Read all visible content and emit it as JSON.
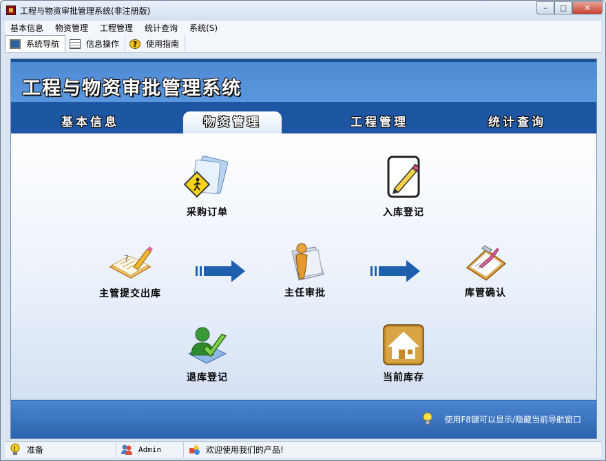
{
  "window": {
    "title": "工程与物资审批管理系统(非注册版)",
    "buttons": {
      "minimize": "–",
      "maximize": "□",
      "close": "✕"
    }
  },
  "menu": {
    "items": [
      {
        "label": "基本信息"
      },
      {
        "label": "物资管理"
      },
      {
        "label": "工程管理"
      },
      {
        "label": "统计查询"
      },
      {
        "label": "系统(S)"
      }
    ]
  },
  "toolbar": {
    "items": [
      {
        "label": "系统导航",
        "icon": "monitor-icon",
        "active": true
      },
      {
        "label": "信息操作",
        "icon": "grid-icon",
        "active": false
      },
      {
        "label": "使用指南",
        "icon": "help-icon",
        "active": false
      }
    ]
  },
  "banner": {
    "title": "工程与物资审批管理系统"
  },
  "tabs": [
    {
      "label": "基本信息",
      "active": false
    },
    {
      "label": "物资管理",
      "active": true
    },
    {
      "label": "工程管理",
      "active": false
    },
    {
      "label": "统计查询",
      "active": false
    }
  ],
  "nodes": {
    "purchase_order": {
      "label": "采购订单",
      "icon": "document-pedestrian-icon"
    },
    "stock_in": {
      "label": "入库登记",
      "icon": "notepad-pencil-icon"
    },
    "submit_out": {
      "label": "主管提交出库",
      "icon": "notebook-pencil-icon"
    },
    "director_approve": {
      "label": "主任审批",
      "icon": "person-folder-icon"
    },
    "keeper_confirm": {
      "label": "库管确认",
      "icon": "clipboard-check-icon"
    },
    "return_stock": {
      "label": "退库登记",
      "icon": "user-check-icon"
    },
    "current_stock": {
      "label": "当前库存",
      "icon": "home-icon"
    }
  },
  "footer": {
    "hint": "使用F8键可以显示/隐藏当前导航窗口"
  },
  "status": {
    "state": "准备",
    "user": "Admin",
    "welcome": "欢迎使用我们的产品!"
  },
  "colors": {
    "banner": "#5b97df",
    "tabbar": "#1d56a2",
    "arrow": "#1e5fae",
    "footer": "#3a74c0"
  }
}
